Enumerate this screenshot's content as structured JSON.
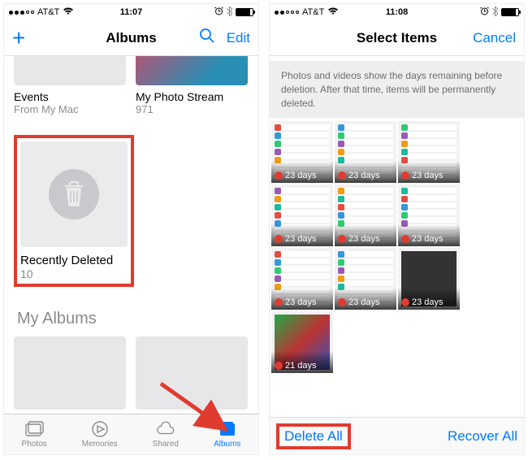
{
  "left": {
    "status": {
      "carrier": "AT&T",
      "time": "11:07"
    },
    "nav": {
      "title": "Albums",
      "edit": "Edit"
    },
    "albums_row": [
      {
        "name": "Events",
        "sub": "From My Mac"
      },
      {
        "name": "My Photo Stream",
        "sub": "971"
      }
    ],
    "recent": {
      "name": "Recently Deleted",
      "count": "10"
    },
    "section": "My Albums",
    "tabs": [
      {
        "label": "Photos"
      },
      {
        "label": "Memories"
      },
      {
        "label": "Shared"
      },
      {
        "label": "Albums"
      }
    ]
  },
  "right": {
    "status": {
      "carrier": "AT&T",
      "time": "11:08"
    },
    "nav": {
      "title": "Select Items",
      "cancel": "Cancel"
    },
    "banner": "Photos and videos show the days remaining before deletion. After that time, items will be permanently deleted.",
    "photos": [
      {
        "days": "23 days"
      },
      {
        "days": "23 days"
      },
      {
        "days": "23 days"
      },
      {
        "days": "23 days"
      },
      {
        "days": "23 days"
      },
      {
        "days": "23 days"
      },
      {
        "days": "23 days"
      },
      {
        "days": "23 days"
      },
      {
        "days": "23 days"
      },
      {
        "days": "21 days"
      }
    ],
    "bottom": {
      "delete": "Delete All",
      "recover": "Recover All"
    }
  }
}
